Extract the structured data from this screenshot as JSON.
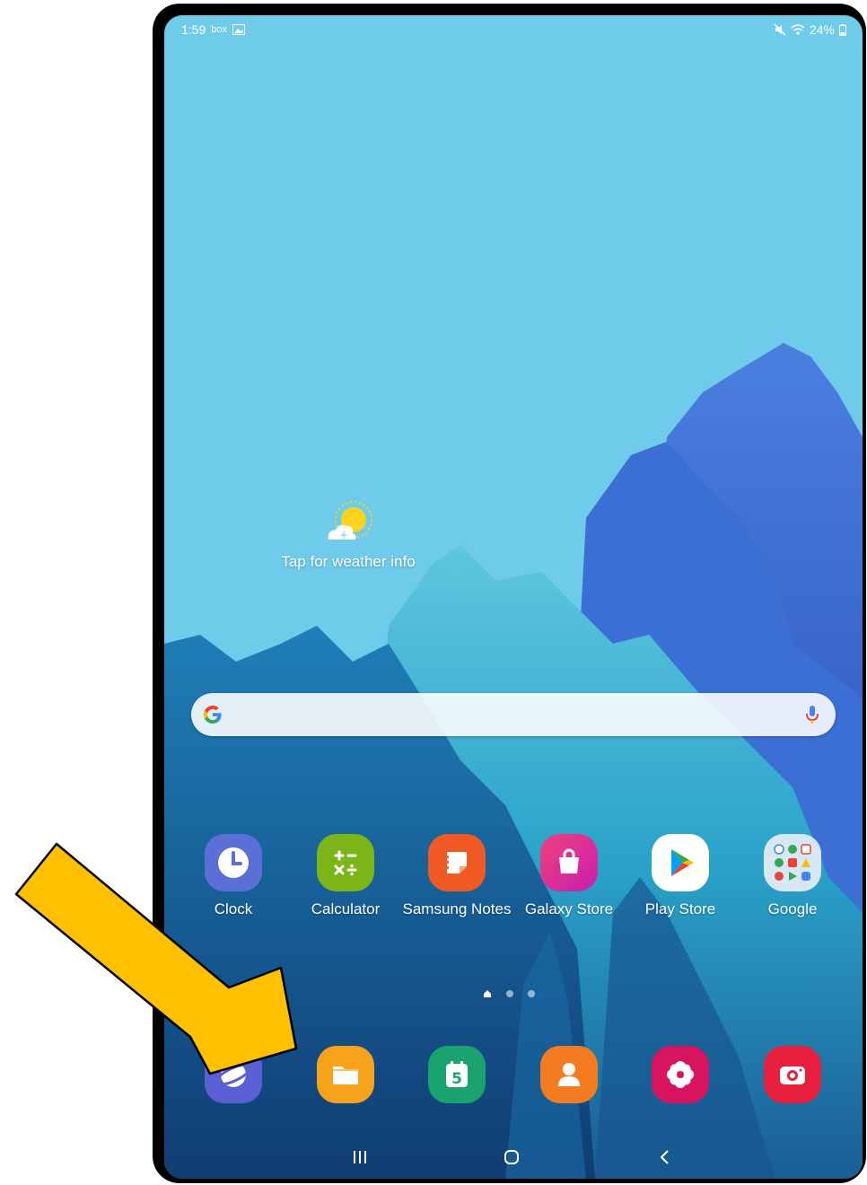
{
  "status_bar": {
    "time": "1:59",
    "left_icons": [
      "box-icon",
      "gallery-icon"
    ],
    "battery": "24%",
    "right_icons": [
      "mute-icon",
      "wifi-icon",
      "battery-icon"
    ]
  },
  "weather": {
    "label": "Tap for weather info",
    "icon": "weather-sun-cloud-icon"
  },
  "search_bar": {
    "logo": "google-g-icon",
    "mic": "microphone-icon"
  },
  "apps": [
    {
      "label": "Clock",
      "icon": "clock-icon",
      "color": "#5b6fd6"
    },
    {
      "label": "Calculator",
      "icon": "calculator-icon",
      "color": "#7cb518"
    },
    {
      "label": "Samsung Notes",
      "icon": "samsung-notes-icon",
      "color": "#f15a24"
    },
    {
      "label": "Galaxy Store",
      "icon": "galaxy-store-icon",
      "color": "#e6277d"
    },
    {
      "label": "Play Store",
      "icon": "play-store-icon",
      "color": "#ffffff"
    },
    {
      "label": "Google",
      "icon": "google-folder-icon",
      "color": "#e8eef5"
    }
  ],
  "page_indicator": {
    "pages": 3,
    "current": 1
  },
  "dock": [
    {
      "icon": "samsung-internet-icon",
      "color": "#5a5fd6"
    },
    {
      "icon": "my-files-icon",
      "color": "#f7a21b"
    },
    {
      "icon": "calendar-icon",
      "color": "#1aa36f",
      "day": "5"
    },
    {
      "icon": "contacts-icon",
      "color": "#f47b20"
    },
    {
      "icon": "gallery-flower-icon",
      "color": "#d6145f"
    },
    {
      "icon": "camera-icon",
      "color": "#e8203e"
    }
  ],
  "nav_bar": [
    "recents-icon",
    "home-icon",
    "back-icon"
  ],
  "annotation": {
    "arrow_color": "#ffc000",
    "points_to": "my-files-icon"
  }
}
